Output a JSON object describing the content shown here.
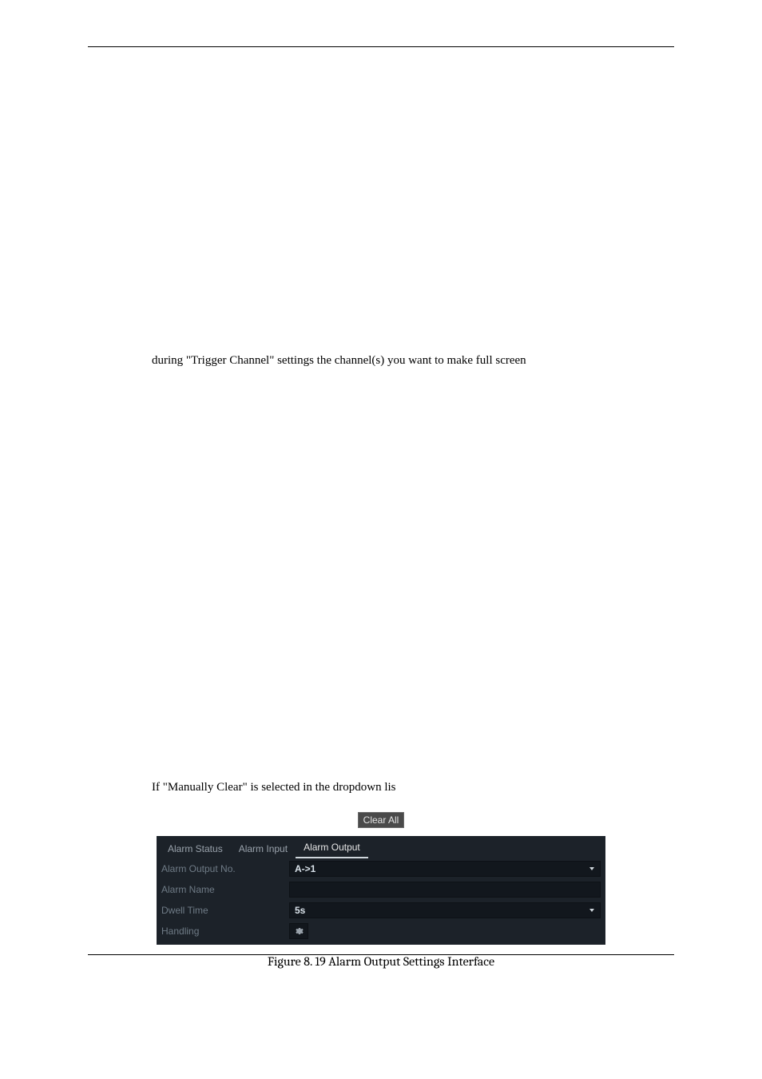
{
  "body": {
    "line1": "during  \"Trigger  Channel\"  settings  the  channel(s)  you  want  to  make  full  screen",
    "line2": "If \"Manually Clear\" is selected in the dropdown lis",
    "clear_btn": "Clear All"
  },
  "ui": {
    "tabs": {
      "status": "Alarm Status",
      "input": "Alarm Input",
      "output": "Alarm Output"
    },
    "rows": {
      "output_no_label": "Alarm Output No.",
      "output_no_value": "A->1",
      "alarm_name_label": "Alarm Name",
      "alarm_name_value": "",
      "dwell_time_label": "Dwell Time",
      "dwell_time_value": "5s",
      "handling_label": "Handling"
    }
  },
  "figure_caption": "Figure 8. 19 Alarm Output Settings Interface"
}
